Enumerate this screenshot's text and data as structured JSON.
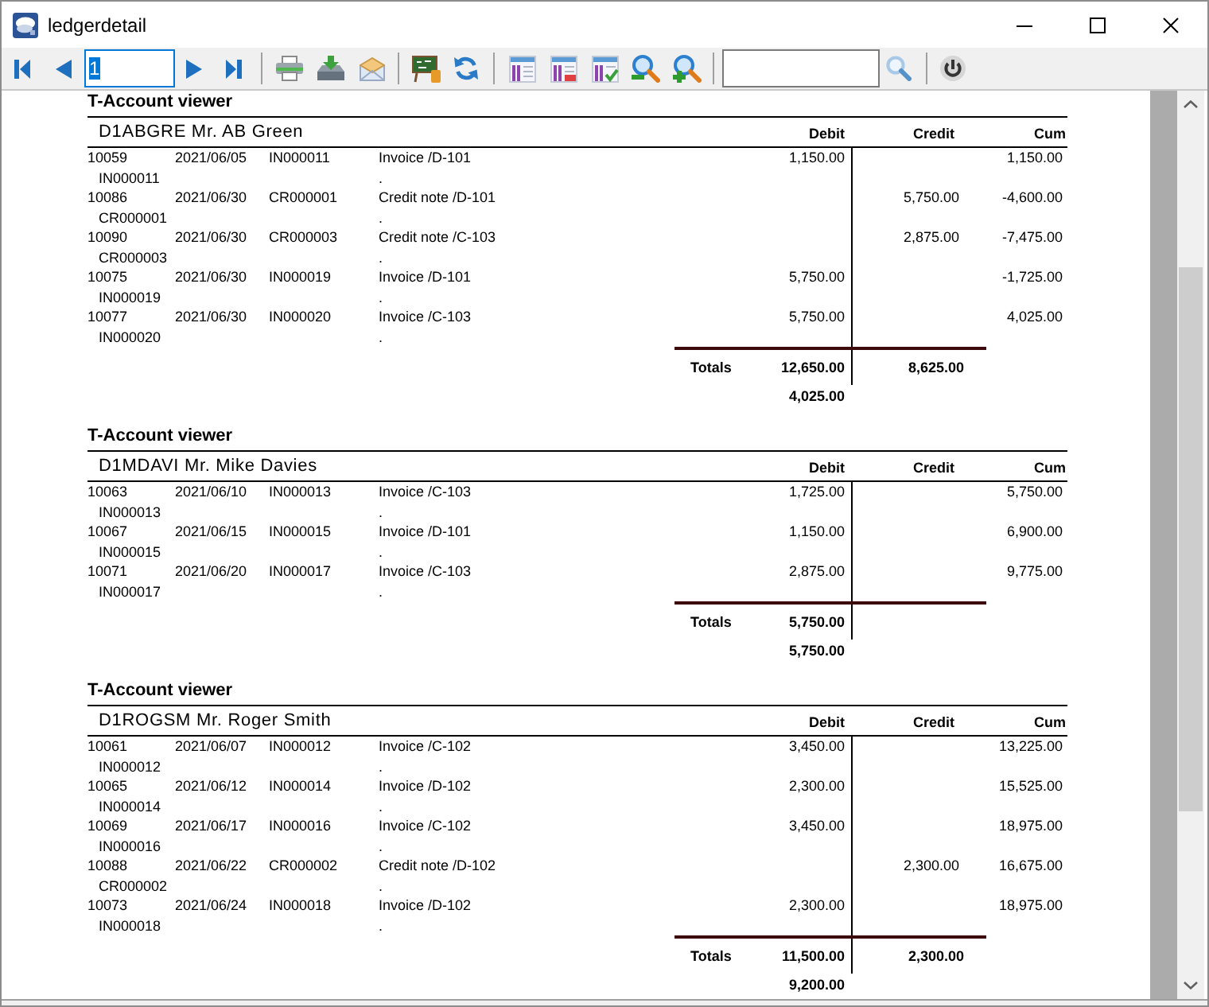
{
  "window": {
    "title": "ledgerdetail"
  },
  "toolbar": {
    "page_field": {
      "value": "1",
      "focused": true
    }
  },
  "report": {
    "sections": [
      {
        "title": "T-Account viewer",
        "account": "D1ABGRE Mr. AB Green",
        "columns": [
          "Debit",
          "Credit",
          "Cum"
        ],
        "entries": [
          {
            "number": "10059",
            "date": "2021/06/05",
            "reference": "IN000011",
            "description": "Invoice /D-101",
            "document": "IN000011",
            "note": ".",
            "debit": "1,150.00",
            "cum": "1,150.00"
          },
          {
            "number": "10086",
            "date": "2021/06/30",
            "reference": "CR000001",
            "description": "Credit note /D-101",
            "document": "CR000001",
            "note": ".",
            "credit": "5,750.00",
            "cum": "-4,600.00"
          },
          {
            "number": "10090",
            "date": "2021/06/30",
            "reference": "CR000003",
            "description": "Credit note /C-103",
            "document": "CR000003",
            "note": ".",
            "credit": "2,875.00",
            "cum": "-7,475.00"
          },
          {
            "number": "10075",
            "date": "2021/06/30",
            "reference": "IN000019",
            "description": "Invoice /D-101",
            "document": "IN000019",
            "note": ".",
            "debit": "5,750.00",
            "cum": "-1,725.00"
          },
          {
            "number": "10077",
            "date": "2021/06/30",
            "reference": "IN000020",
            "description": "Invoice /C-103",
            "document": "IN000020",
            "note": ".",
            "debit": "5,750.00",
            "cum": "4,025.00"
          }
        ],
        "totals": {
          "label": "Totals",
          "debit": "12,650.00",
          "credit": "8,625.00"
        },
        "balance": "4,025.00"
      },
      {
        "title": "T-Account viewer",
        "account": "D1MDAVI Mr. Mike Davies",
        "columns": [
          "Debit",
          "Credit",
          "Cum"
        ],
        "entries": [
          {
            "number": "10063",
            "date": "2021/06/10",
            "reference": "IN000013",
            "description": "Invoice /C-103",
            "document": "IN000013",
            "note": ".",
            "debit": "1,725.00",
            "cum": "5,750.00"
          },
          {
            "number": "10067",
            "date": "2021/06/15",
            "reference": "IN000015",
            "description": "Invoice /D-101",
            "document": "IN000015",
            "note": ".",
            "debit": "1,150.00",
            "cum": "6,900.00"
          },
          {
            "number": "10071",
            "date": "2021/06/20",
            "reference": "IN000017",
            "description": "Invoice /C-103",
            "document": "IN000017",
            "note": ".",
            "debit": "2,875.00",
            "cum": "9,775.00"
          }
        ],
        "totals": {
          "label": "Totals",
          "debit": "5,750.00"
        },
        "balance": "5,750.00"
      },
      {
        "title": "T-Account viewer",
        "account": "D1ROGSM Mr. Roger Smith",
        "columns": [
          "Debit",
          "Credit",
          "Cum"
        ],
        "entries": [
          {
            "number": "10061",
            "date": "2021/06/07",
            "reference": "IN000012",
            "description": "Invoice /C-102",
            "document": "IN000012",
            "note": ".",
            "debit": "3,450.00",
            "cum": "13,225.00"
          },
          {
            "number": "10065",
            "date": "2021/06/12",
            "reference": "IN000014",
            "description": "Invoice /D-102",
            "document": "IN000014",
            "note": ".",
            "debit": "2,300.00",
            "cum": "15,525.00"
          },
          {
            "number": "10069",
            "date": "2021/06/17",
            "reference": "IN000016",
            "description": "Invoice /C-102",
            "document": "IN000016",
            "note": ".",
            "debit": "3,450.00",
            "cum": "18,975.00"
          },
          {
            "number": "10088",
            "date": "2021/06/22",
            "reference": "CR000002",
            "description": "Credit note /D-102",
            "document": "CR000002",
            "note": ".",
            "credit": "2,300.00",
            "cum": "16,675.00"
          },
          {
            "number": "10073",
            "date": "2021/06/24",
            "reference": "IN000018",
            "description": "Invoice /D-102",
            "document": "IN000018",
            "note": ".",
            "debit": "2,300.00",
            "cum": "18,975.00"
          }
        ],
        "totals": {
          "label": "Totals",
          "debit": "11,500.00",
          "credit": "2,300.00"
        },
        "balance": "9,200.00"
      }
    ]
  }
}
